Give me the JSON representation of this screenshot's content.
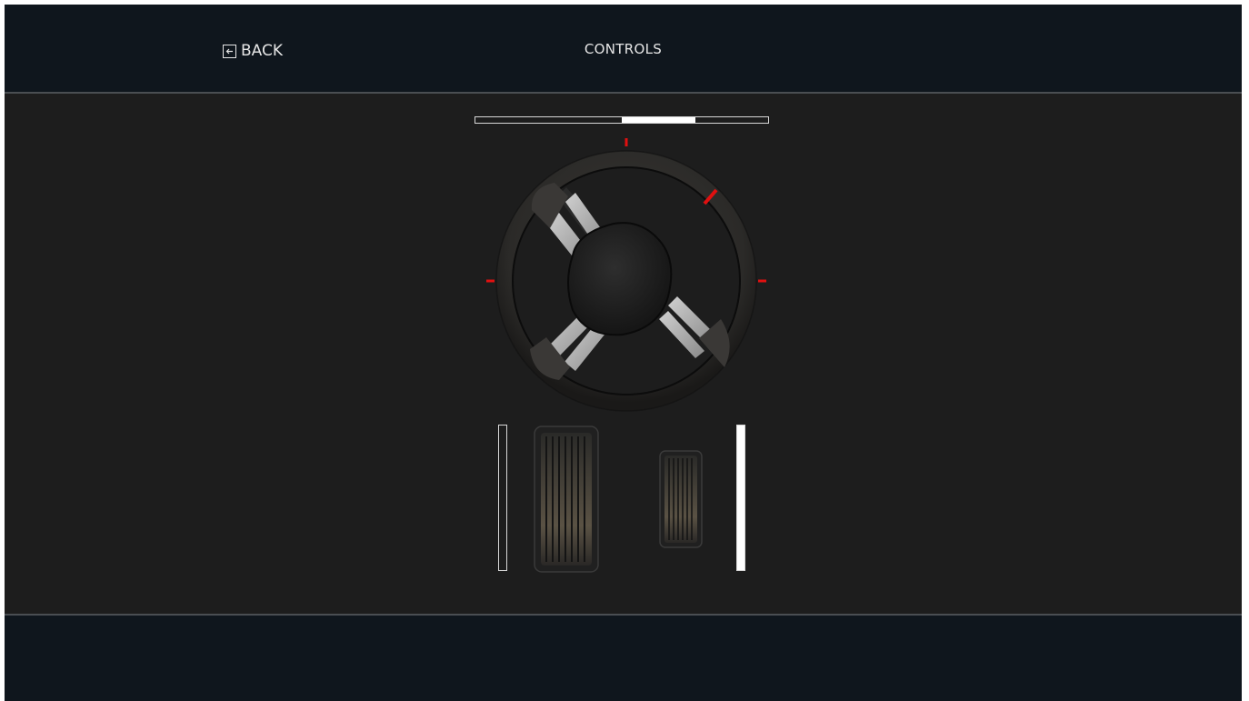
{
  "header": {
    "back_label": "BACK",
    "back_icon": "back-arrow-icon",
    "title": "CONTROLS"
  },
  "controls": {
    "steering": {
      "indicator_start_fraction": 0.5,
      "indicator_end_fraction": 0.75,
      "wheel_icon": "steering-wheel-icon"
    },
    "brake": {
      "level": 0.0,
      "pedal_icon": "brake-pedal-icon"
    },
    "throttle": {
      "level": 1.0,
      "pedal_icon": "gas-pedal-icon"
    }
  },
  "colors": {
    "header_bg": "#0f161d",
    "panel_bg": "#1d1d1d",
    "accent_red": "#e01010",
    "bar_fill": "#ffffff"
  }
}
